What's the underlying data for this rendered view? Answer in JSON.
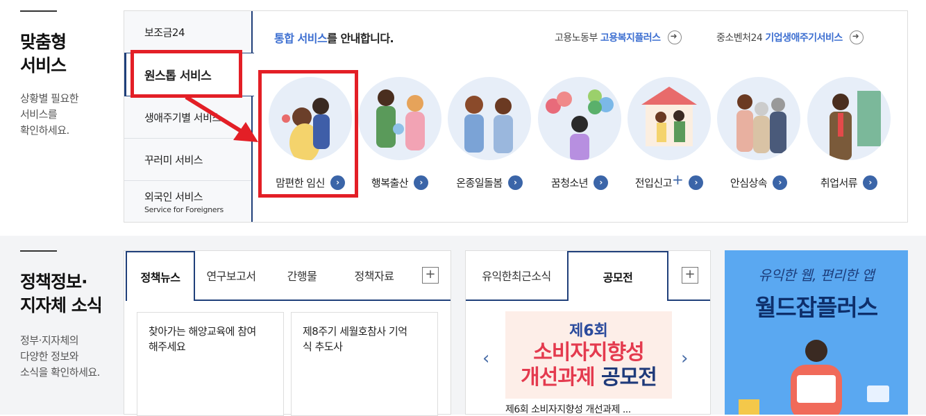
{
  "section1": {
    "title_line1": "맞춤형",
    "title_line2": "서비스",
    "desc_line1": "상황별 필요한",
    "desc_line2": "서비스를",
    "desc_line3": "확인하세요.",
    "tabs": [
      {
        "label": "보조금24",
        "sub": ""
      },
      {
        "label": "원스톱 서비스",
        "sub": ""
      },
      {
        "label": "생애주기별 서비스",
        "sub": ""
      },
      {
        "label": "꾸러미 서비스",
        "sub": ""
      },
      {
        "label": "외국인 서비스",
        "sub": "Service for Foreigners"
      }
    ],
    "intro_highlight": "통합 서비스",
    "intro_rest": "를 안내합니다.",
    "links": [
      {
        "prefix": "고용노동부",
        "label": "고용복지플러스"
      },
      {
        "prefix": "중소벤처24",
        "label": "기업생애주기서비스"
      }
    ],
    "services": [
      {
        "label": "맘편한 임신",
        "icon": "pregnant-couple-illustration"
      },
      {
        "label": "행복출산",
        "icon": "parents-with-baby-illustration"
      },
      {
        "label": "온종일돌봄",
        "icon": "children-illustration"
      },
      {
        "label": "꿈청소년",
        "icon": "teen-with-balloons-illustration"
      },
      {
        "label": "전입신고",
        "plus": "+",
        "icon": "house-couple-illustration"
      },
      {
        "label": "안심상속",
        "icon": "family-illustration"
      },
      {
        "label": "취업서류",
        "icon": "job-seeker-illustration"
      }
    ]
  },
  "section2": {
    "title_line1": "정책정보·",
    "title_line2": "지자체 소식",
    "desc_line1": "정부·지자체의",
    "desc_line2": "다양한 정보와",
    "desc_line3": "소식을 확인하세요.",
    "news_tabs": [
      "정책뉴스",
      "연구보고서",
      "간행물",
      "정책자료"
    ],
    "news_cards": [
      {
        "line1": "찾아가는 해양교육에 참여",
        "line2": "해주세요"
      },
      {
        "line1": "제8주기 세월호참사 기억",
        "line2": "식 추도사"
      }
    ],
    "notice_tabs": [
      "유익한최근소식",
      "공모전"
    ],
    "poster": {
      "l1": "제6회",
      "l2": "소비자지향성",
      "l3a": "개선과제",
      "l3b": "공모전"
    },
    "poster_caption": "제6회 소비자지향성 개선과제 ...",
    "banner": {
      "tagline": "유익한 웹, 편리한 앱",
      "title": "월드잡플러스"
    }
  },
  "colors": {
    "accent": "#3d6fd1",
    "navy": "#1f3f7a",
    "annotation": "#e31f26",
    "banner": "#5aa8f1"
  }
}
